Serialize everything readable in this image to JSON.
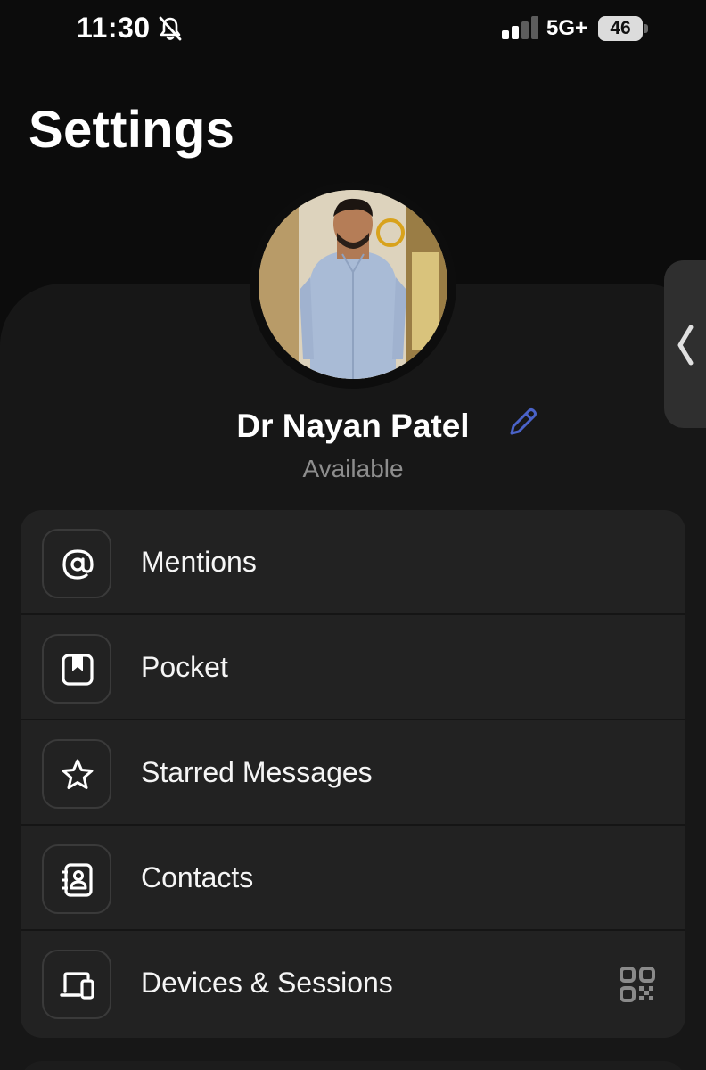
{
  "status_bar": {
    "time": "11:30",
    "network": "5G+",
    "battery": "46",
    "icons": [
      "bell-slash-icon",
      "signal-icon",
      "battery-icon"
    ]
  },
  "page": {
    "title": "Settings"
  },
  "profile": {
    "name": "Dr Nayan Patel",
    "status": "Available",
    "edit_icon": "pencil-icon",
    "edit_color": "#4a63c9"
  },
  "menu": {
    "items": [
      {
        "label": "Mentions",
        "icon": "at-icon"
      },
      {
        "label": "Pocket",
        "icon": "bookmark-icon"
      },
      {
        "label": "Starred Messages",
        "icon": "star-icon"
      },
      {
        "label": "Contacts",
        "icon": "contacts-book-icon"
      },
      {
        "label": "Devices & Sessions",
        "icon": "devices-icon",
        "trailing_icon": "qr-code-icon"
      }
    ]
  },
  "side_panel": {
    "icon": "chevron-left-icon"
  },
  "colors": {
    "background": "#0c0c0c",
    "sheet": "#171717",
    "card": "#222222",
    "muted_text": "#8d8d8d",
    "accent": "#4a63c9"
  }
}
